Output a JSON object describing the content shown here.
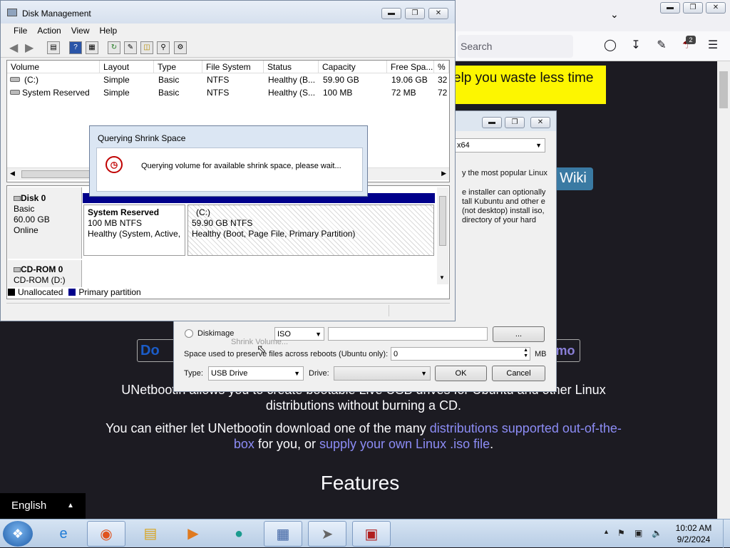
{
  "firefox": {
    "search_placeholder": "Search",
    "notification_count": "2",
    "hero_text": "elp you waste less time",
    "wiki_label": "Wiki",
    "download_label": "Do",
    "demo_label": "mo",
    "para1": "UNetbootin allows you to create bootable Live USB drives for Ubuntu and other Linux distributions without burning a CD.",
    "para2_a": "You can either let UNetbootin download one of the many ",
    "para2_link1": "distributions supported out-of-the-box",
    "para2_b": " for you, or ",
    "para2_link2": "supply your own Linux .iso file",
    "para2_c": ".",
    "features_heading": "Features",
    "language": "English"
  },
  "unetbootin": {
    "distro_value": "x64",
    "desc": "y the most popular Linux",
    "desc2": "e installer can optionally tall Kubuntu and other e (not desktop) install iso, directory of your hard",
    "diskimage_label": "Diskimage",
    "diskimage_type": "ISO",
    "browse_label": "...",
    "space_label": "Space used to preserve files across reboots (Ubuntu only):",
    "space_value": "0",
    "space_unit": "MB",
    "type_label": "Type:",
    "type_value": "USB Drive",
    "drive_label": "Drive:",
    "ok_label": "OK",
    "cancel_label": "Cancel",
    "ghost_menu_item": "Shrink Volume..."
  },
  "disk_mgmt": {
    "title": "Disk Management",
    "menu": [
      "File",
      "Action",
      "View",
      "Help"
    ],
    "columns": [
      "Volume",
      "Layout",
      "Type",
      "File System",
      "Status",
      "Capacity",
      "Free Spa...",
      "% F"
    ],
    "rows": [
      [
        "(C:)",
        "Simple",
        "Basic",
        "NTFS",
        "Healthy (B...",
        "59.90 GB",
        "19.06 GB",
        "32"
      ],
      [
        "System Reserved",
        "Simple",
        "Basic",
        "NTFS",
        "Healthy (S...",
        "100 MB",
        "72 MB",
        "72"
      ]
    ],
    "disk0": {
      "name": "Disk 0",
      "type": "Basic",
      "size": "60.00 GB",
      "state": "Online"
    },
    "cdrom0": {
      "name": "CD-ROM 0",
      "drive": "CD-ROM (D:)"
    },
    "partition1": {
      "name": "System Reserved",
      "size": "100 MB NTFS",
      "status": "Healthy (System, Active,"
    },
    "partition2": {
      "name": "(C:)",
      "size": "59.90 GB NTFS",
      "status": "Healthy (Boot, Page File, Primary Partition)"
    },
    "legend": [
      {
        "label": "Unallocated",
        "color": "#000000"
      },
      {
        "label": "Primary partition",
        "color": "#00008b"
      }
    ]
  },
  "query_dialog": {
    "title": "Querying Shrink Space",
    "message": "Querying volume for available shrink space, please wait..."
  },
  "taskbar": {
    "time": "10:02 AM",
    "date": "9/2/2024"
  }
}
